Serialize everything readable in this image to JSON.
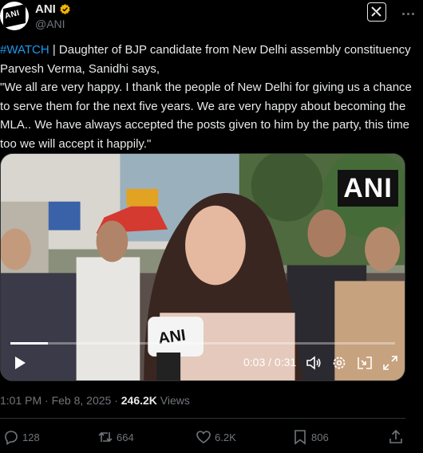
{
  "author": {
    "name": "ANI",
    "handle": "@ANI",
    "avatar_text": "ANI",
    "verified_color": "#f4b400"
  },
  "tweet": {
    "hashtag": "#WATCH",
    "text_line1": " | Daughter of BJP candidate from New Delhi assembly constituency Parvesh Verma, Sanidhi says,",
    "text_quote": "\"We all are very happy. I thank the people of New Delhi for giving us a chance to serve them for the next five years. We are very happy about becoming the MLA.. We have always accepted the posts given to him by the party, this time too we will accept it happily.\""
  },
  "video": {
    "watermark": "ANI",
    "mic_label": "ANI",
    "time_display": "0:03 / 0:31",
    "progress": 0.097
  },
  "meta": {
    "time": "1:01 PM · Feb 8, 2025 · ",
    "views_count": "246.2K",
    "views_label": " Views"
  },
  "actions": {
    "replies": "128",
    "reposts": "664",
    "likes": "6.2K",
    "bookmarks": "806"
  },
  "colors": {
    "background": "#000000",
    "text": "#e7e9ea",
    "muted": "#71767b",
    "link": "#1d9bf0"
  },
  "icons": [
    "verified-badge-icon",
    "grok-icon",
    "more-icon",
    "play-icon",
    "volume-icon",
    "settings-icon",
    "pip-icon",
    "fullscreen-icon",
    "reply-icon",
    "repost-icon",
    "like-icon",
    "bookmark-icon",
    "share-icon"
  ]
}
